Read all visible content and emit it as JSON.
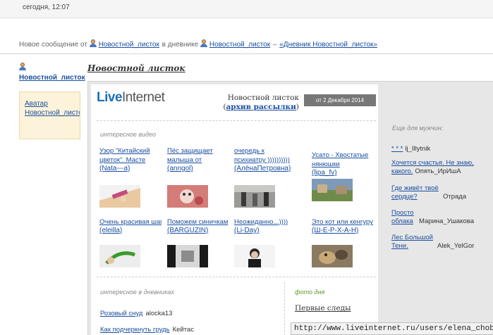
{
  "timestamp": "сегодня, 12:07",
  "notice": {
    "prefix": "Новое сообщение от",
    "from_user": "Новостной_листок",
    "middle": "в дневнике",
    "diary_user": "Новостной_листок",
    "dash": "–",
    "diary_link": "«Дневник Новостной_листок»"
  },
  "sidebar": {
    "user_name": "Новостной_листок",
    "links": [
      "Аватар",
      "Новостной_листок"
    ]
  },
  "post": {
    "title": "Новостной листок"
  },
  "newsletter": {
    "logo_part1": "Live",
    "logo_part2": "Internet",
    "title_text": "Новостной листок (",
    "title_link": "архив рассылки",
    "title_close": ")",
    "date": "от 2 Декабря 2014",
    "video_section_label": "интересное видео",
    "videos": [
      {
        "title": "Узор \"Китайский цветок\". Масте",
        "author": "(Nata---a)"
      },
      {
        "title": "Пёс защищает малыша от пылесос",
        "author": "(anngol)"
      },
      {
        "title": "очередь к психиатру ))))))))))",
        "author": "(АлёнаПетровна)"
      },
      {
        "title": "Усато - Хвостатые нянюшки",
        "author": "(lipa_fv)"
      },
      {
        "title": "Очень красивая шапочка.",
        "author": "(eleilla)"
      },
      {
        "title": "Поможем синичкам",
        "author": "(BARGUZIN)"
      },
      {
        "title": "Неожиданно...))))",
        "author": "(Li-Day)"
      },
      {
        "title": "Это кот или кенгуру",
        "author": "(Ш-Е-Р-Х-А-Н)"
      }
    ],
    "diaries_section_label": "интересное в дневниках",
    "diaries": [
      {
        "title": "Розовый снуд",
        "author": "alocka13"
      },
      {
        "title": "Как подчеркнуть грудь",
        "author": "Кейтас"
      }
    ],
    "photo_section_label": "фото дня",
    "photo_title": "Первые следы",
    "side_label": "Еще для мужчин:",
    "side_items": [
      {
        "title": "* * *",
        "author": "lj_Illytnik"
      },
      {
        "title": "Хочется счастья. Не знаю, какого.",
        "author": "Опять_ИрИшА"
      },
      {
        "title": "Где живёт твоё сердце?",
        "author": "Отрада"
      },
      {
        "title": "Просто облака",
        "author": "Марина_Ушакова"
      },
      {
        "title": "Лес Большой Тени.",
        "author": "Alek_YelGor"
      }
    ]
  },
  "status_bar": {
    "url": "http://www.liveinternet.ru/users/elena_choban/"
  },
  "colors": {
    "link": "#1a4fa0",
    "sidebar_box": "#fdf3da",
    "newsletter_bg": "#e7e7e7",
    "date_badge": "#777777",
    "photo_label": "#5e9a2a"
  }
}
